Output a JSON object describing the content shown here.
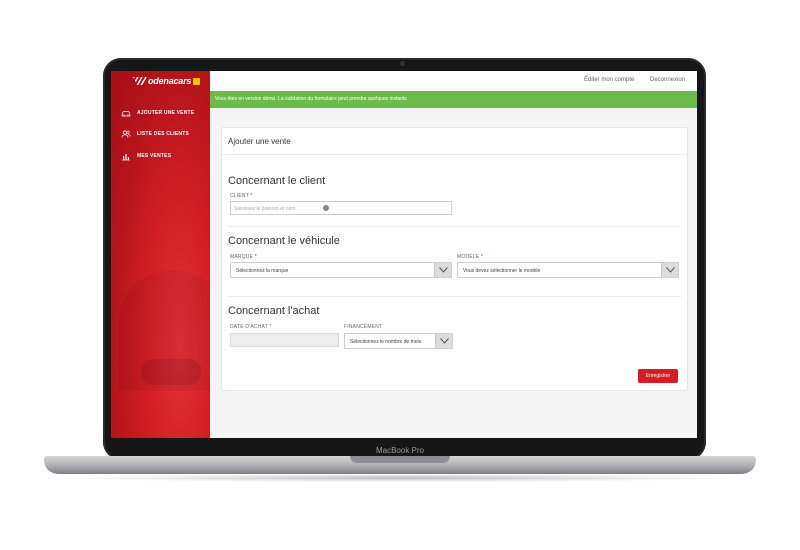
{
  "device": {
    "label": "MacBook Pro"
  },
  "brand": {
    "name": "odenacars"
  },
  "sidebar": {
    "items": [
      {
        "label": "AJOUTER UNE VENTE",
        "icon": "car-icon"
      },
      {
        "label": "LISTE DES CLIENTS",
        "icon": "users-icon"
      },
      {
        "label": "MES VENTES",
        "icon": "bar-chart-icon"
      }
    ]
  },
  "topbar": {
    "edit_account": "Éditer mon compte",
    "logout": "Deconnexion"
  },
  "banner": {
    "text": "Vous êtes en version démo. La validation du formulaire peut prendre quelques instants"
  },
  "form": {
    "title": "Ajouter une vente",
    "client_section": {
      "title": "Concernant le client",
      "client_label": "CLIENT",
      "client_placeholder": "Saisissez le prénom et nom"
    },
    "vehicle_section": {
      "title": "Concernant le véhicule",
      "brand_label": "MARQUE",
      "brand_value": "Sélectionnez la marque",
      "model_label": "MODÈLE",
      "model_value": "Vous devez sélectionner le modèle"
    },
    "purchase_section": {
      "title": "Concernant l'achat",
      "date_label": "DATE D'ACHAT",
      "financing_label": "FINANCEMENT",
      "financing_value": "Sélectionnez le nombre de mois"
    },
    "required_marker": "*",
    "save_label": "Enregistrer"
  },
  "colors": {
    "accent": "#d41e25",
    "banner": "#6abb4a"
  }
}
